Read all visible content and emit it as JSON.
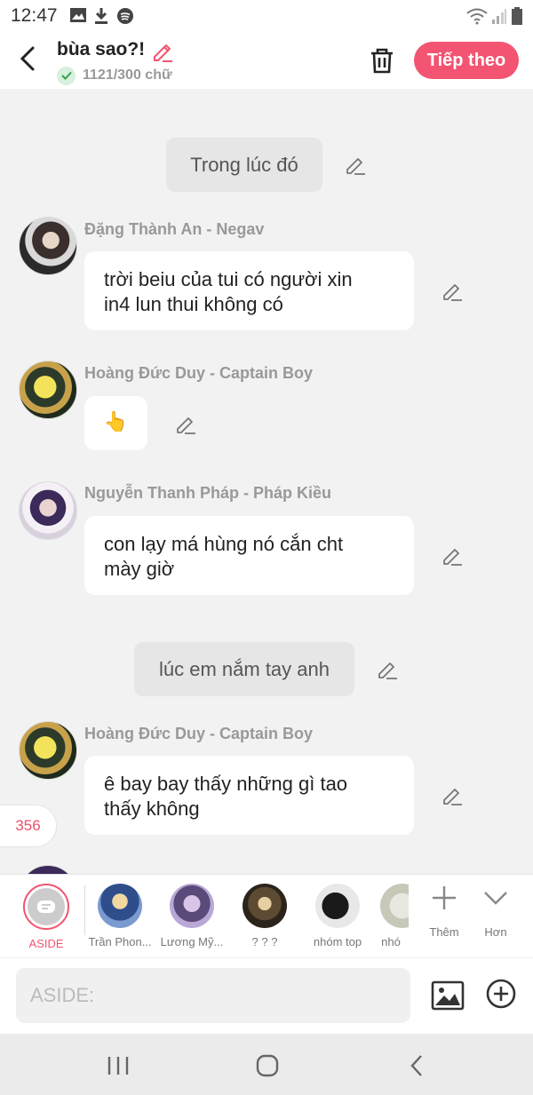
{
  "status": {
    "time": "12:47"
  },
  "header": {
    "title": "bùa sao?!",
    "word_count": "1121/300 chữ",
    "next_label": "Tiếp theo",
    "accent": "#f25471"
  },
  "messages": [
    {
      "type": "narration",
      "text": "Trong lúc đó"
    },
    {
      "type": "dialog",
      "speaker": "Đặng Thành An - Negav",
      "text_lines": [
        "trời beiu của tui có người xin",
        "in4 lun thui không có"
      ]
    },
    {
      "type": "dialog",
      "speaker": "Hoàng Đức Duy - Captain Boy",
      "text": "👆"
    },
    {
      "type": "dialog",
      "speaker": "Nguyễn Thanh Pháp - Pháp Kiều",
      "text_lines": [
        "con lạy má hùng nó cắn cht",
        "mày giờ"
      ]
    },
    {
      "type": "narration",
      "text": "lúc em nắm tay anh"
    },
    {
      "type": "dialog",
      "speaker": "Hoàng Đức Duy - Captain Boy",
      "text_lines": [
        "ê bay bay thấy những gì tao",
        "thấy không"
      ]
    }
  ],
  "side_count": "356",
  "characters": [
    {
      "name": "ASIDE"
    },
    {
      "name": "Trần Phon..."
    },
    {
      "name": "Lương Mỹ..."
    },
    {
      "name": "? ? ?"
    },
    {
      "name": "nhóm top"
    },
    {
      "name": "nhó"
    }
  ],
  "actions": {
    "more_label": "Thêm",
    "less_label": "Hơn"
  },
  "input": {
    "placeholder": "ASIDE:"
  }
}
